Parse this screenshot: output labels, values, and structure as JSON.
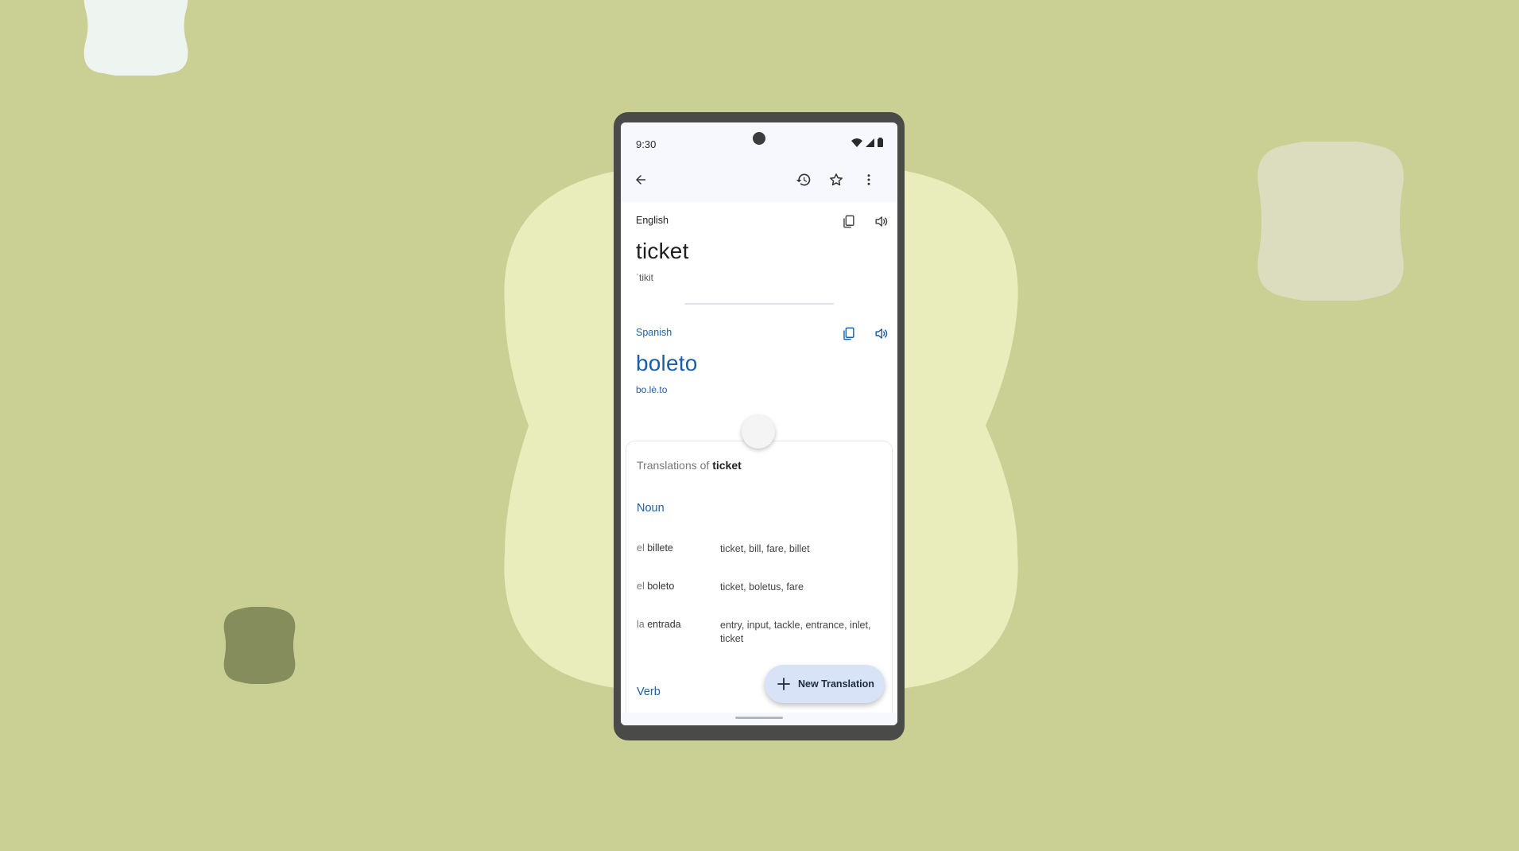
{
  "status_bar": {
    "time": "9:30"
  },
  "source": {
    "language": "English",
    "word": "ticket",
    "phonetic": "ˈtikit"
  },
  "target": {
    "language": "Spanish",
    "word": "boleto",
    "phonetic": "bo.lè.to"
  },
  "translations": {
    "title_prefix": "Translations of",
    "title_word": "ticket",
    "sections": [
      {
        "pos": "Noun",
        "rows": [
          {
            "article": "el",
            "term": "billete",
            "synonyms": "ticket, bill, fare, billet"
          },
          {
            "article": "el",
            "term": "boleto",
            "synonyms": "ticket, boletus, fare"
          },
          {
            "article": "la",
            "term": "entrada",
            "synonyms": "entry, input, tackle, entrance, inlet, ticket"
          }
        ]
      },
      {
        "pos": "Verb",
        "rows": []
      }
    ]
  },
  "fab": {
    "label": "New Translation"
  },
  "colors": {
    "background": "#cacf93",
    "accent_blue": "#1b5fa8",
    "fab_bg": "#d8e3f8"
  },
  "icons": {
    "back": "arrow-back-icon",
    "history": "history-icon",
    "favorite": "star-outline-icon",
    "more": "more-vert-icon",
    "copy": "copy-icon",
    "speak": "volume-icon",
    "add": "plus-icon"
  }
}
